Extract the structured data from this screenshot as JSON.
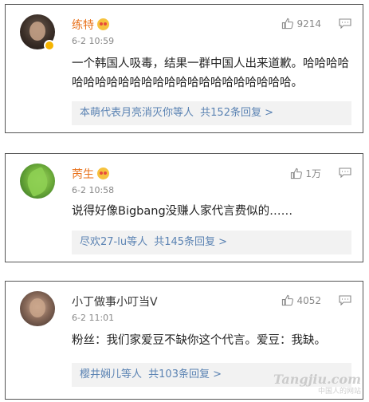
{
  "comments": [
    {
      "username": "练特",
      "verified": true,
      "timestamp": "6-2 10:59",
      "likes": "9214",
      "text": "一个韩国人吸毒，结果一群中国人出来道歉。哈哈哈哈哈哈哈哈哈哈哈哈哈哈哈哈哈哈哈哈哈哈哈。",
      "reply_names": "本萌代表月亮消灭你等人",
      "reply_count": "共152条回复 >"
    },
    {
      "username": "苪生",
      "verified": false,
      "timestamp": "6-2 10:58",
      "likes": "1万",
      "text": "说得好像Bigbang没赚人家代言费似的……",
      "reply_names": "尽欢27-lu等人",
      "reply_count": "共145条回复 >"
    },
    {
      "username": "小丁做事小叮当V",
      "verified": false,
      "timestamp": "6-2 11:01",
      "likes": "4052",
      "text": "粉丝：我们家爱豆不缺你这个代言。爱豆：我缺。",
      "reply_names": "樱井娴儿等人",
      "reply_count": "共103条回复 >"
    }
  ],
  "watermark": {
    "brand": "Tangjiu.com",
    "sub": "中国人的网站"
  },
  "icons": {
    "like": "thumbs-up-icon",
    "comment": "comment-icon",
    "emoji": "emoji-face-icon"
  },
  "colors": {
    "username_highlight": "#e8711b",
    "reply_link": "#5b83b3",
    "reply_bg": "#f2f2f2"
  }
}
